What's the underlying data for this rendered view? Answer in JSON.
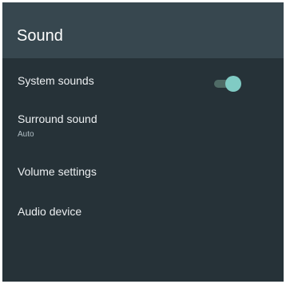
{
  "header": {
    "title": "Sound"
  },
  "settings": {
    "items": [
      {
        "label": "System sounds",
        "toggle": true
      },
      {
        "label": "Surround sound",
        "subtitle": "Auto"
      },
      {
        "label": "Volume settings"
      },
      {
        "label": "Audio device"
      }
    ]
  },
  "colors": {
    "background": "#263238",
    "header_background": "#37474f",
    "toggle_accent": "#80cbc4",
    "toggle_track": "#4f6b66"
  }
}
